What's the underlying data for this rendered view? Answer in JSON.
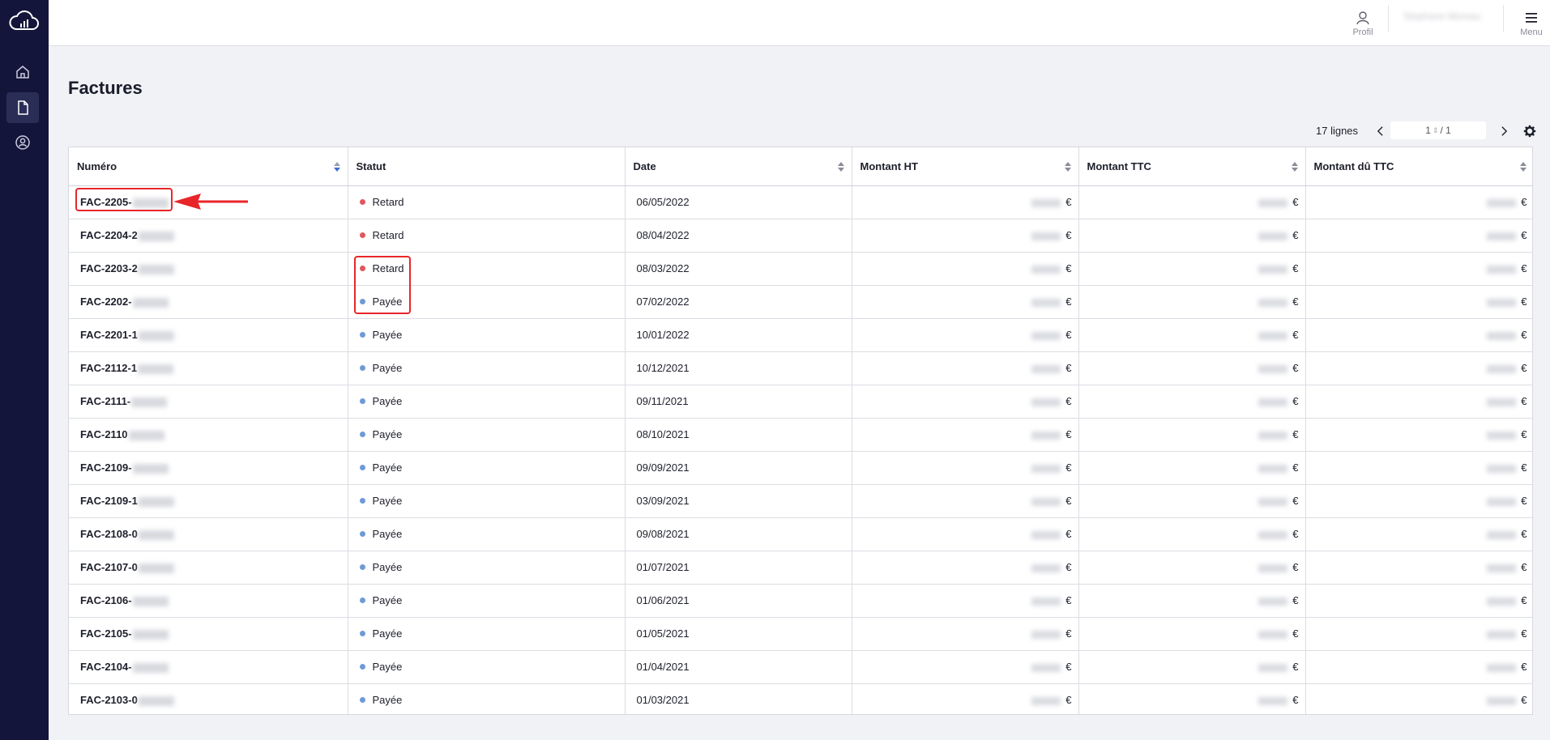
{
  "header": {
    "profile_label": "Profil",
    "menu_label": "Menu",
    "user_name": "Stephane Moreau"
  },
  "page": {
    "title": "Factures"
  },
  "pagination": {
    "rows_count": "17 lignes",
    "current_page": "1",
    "total_pages": "/ 1"
  },
  "table": {
    "columns": [
      "Numéro",
      "Statut",
      "Date",
      "Montant HT",
      "Montant TTC",
      "Montant dû TTC"
    ],
    "currency": "€",
    "rows": [
      {
        "numero": "FAC-2205-",
        "statut": "Retard",
        "date": "06/05/2022",
        "late": true
      },
      {
        "numero": "FAC-2204-2",
        "statut": "Retard",
        "date": "08/04/2022",
        "late": true
      },
      {
        "numero": "FAC-2203-2",
        "statut": "Retard",
        "date": "08/03/2022",
        "late": true
      },
      {
        "numero": "FAC-2202-",
        "statut": "Payée",
        "date": "07/02/2022",
        "late": false
      },
      {
        "numero": "FAC-2201-1",
        "statut": "Payée",
        "date": "10/01/2022",
        "late": false
      },
      {
        "numero": "FAC-2112-1",
        "statut": "Payée",
        "date": "10/12/2021",
        "late": false
      },
      {
        "numero": "FAC-2111-",
        "statut": "Payée",
        "date": "09/11/2021",
        "late": false
      },
      {
        "numero": "FAC-2110",
        "statut": "Payée",
        "date": "08/10/2021",
        "late": false
      },
      {
        "numero": "FAC-2109-",
        "statut": "Payée",
        "date": "09/09/2021",
        "late": false
      },
      {
        "numero": "FAC-2109-1",
        "statut": "Payée",
        "date": "03/09/2021",
        "late": false
      },
      {
        "numero": "FAC-2108-0",
        "statut": "Payée",
        "date": "09/08/2021",
        "late": false
      },
      {
        "numero": "FAC-2107-0",
        "statut": "Payée",
        "date": "01/07/2021",
        "late": false
      },
      {
        "numero": "FAC-2106-",
        "statut": "Payée",
        "date": "01/06/2021",
        "late": false
      },
      {
        "numero": "FAC-2105-",
        "statut": "Payée",
        "date": "01/05/2021",
        "late": false
      },
      {
        "numero": "FAC-2104-",
        "statut": "Payée",
        "date": "01/04/2021",
        "late": false
      },
      {
        "numero": "FAC-2103-0",
        "statut": "Payée",
        "date": "01/03/2021",
        "late": false
      }
    ]
  },
  "colors": {
    "sidebar_bg": "#13163a",
    "status_late": "#e0585c",
    "status_paid": "#6f9ad6",
    "annotation": "#e8262a"
  }
}
